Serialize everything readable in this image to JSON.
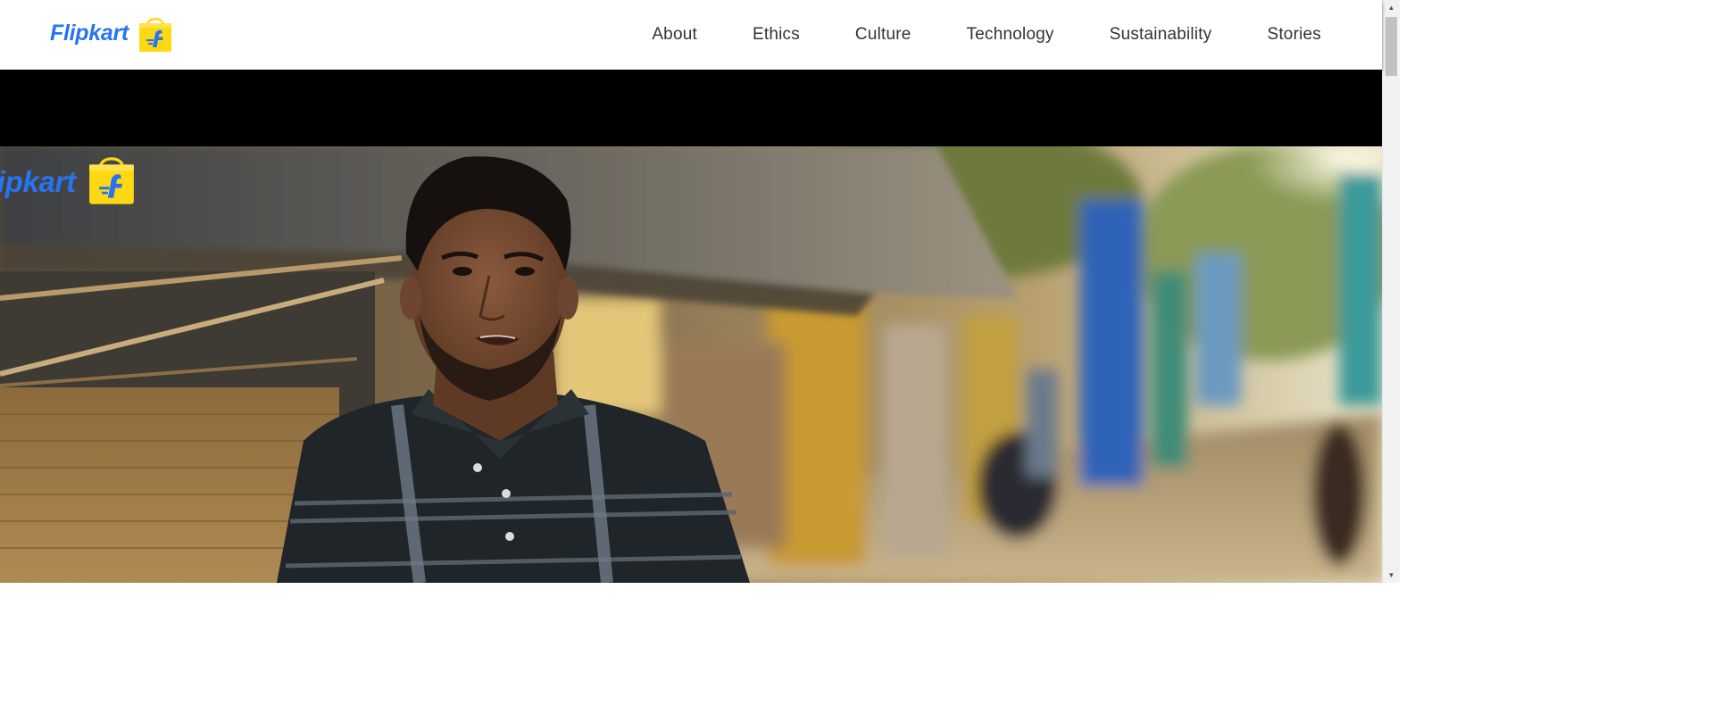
{
  "brand": {
    "wordmark": "Flipkart",
    "icon": "flipkart-bag-icon",
    "color": "#2874f0",
    "bag_color": "#ffd814"
  },
  "nav": {
    "items": [
      {
        "label": "About"
      },
      {
        "label": "Ethics"
      },
      {
        "label": "Culture"
      },
      {
        "label": "Technology"
      },
      {
        "label": "Sustainability"
      },
      {
        "label": "Stories"
      }
    ]
  },
  "hero": {
    "watermark_text": "Flipkart",
    "watermark_icon": "flipkart-bag-icon",
    "subject": "man in striped polo shirt in village lane"
  },
  "scrollbar": {
    "up_icon": "scroll-up-arrow-icon",
    "down_icon": "scroll-down-arrow-icon",
    "up_glyph": "▲",
    "down_glyph": "▼"
  }
}
